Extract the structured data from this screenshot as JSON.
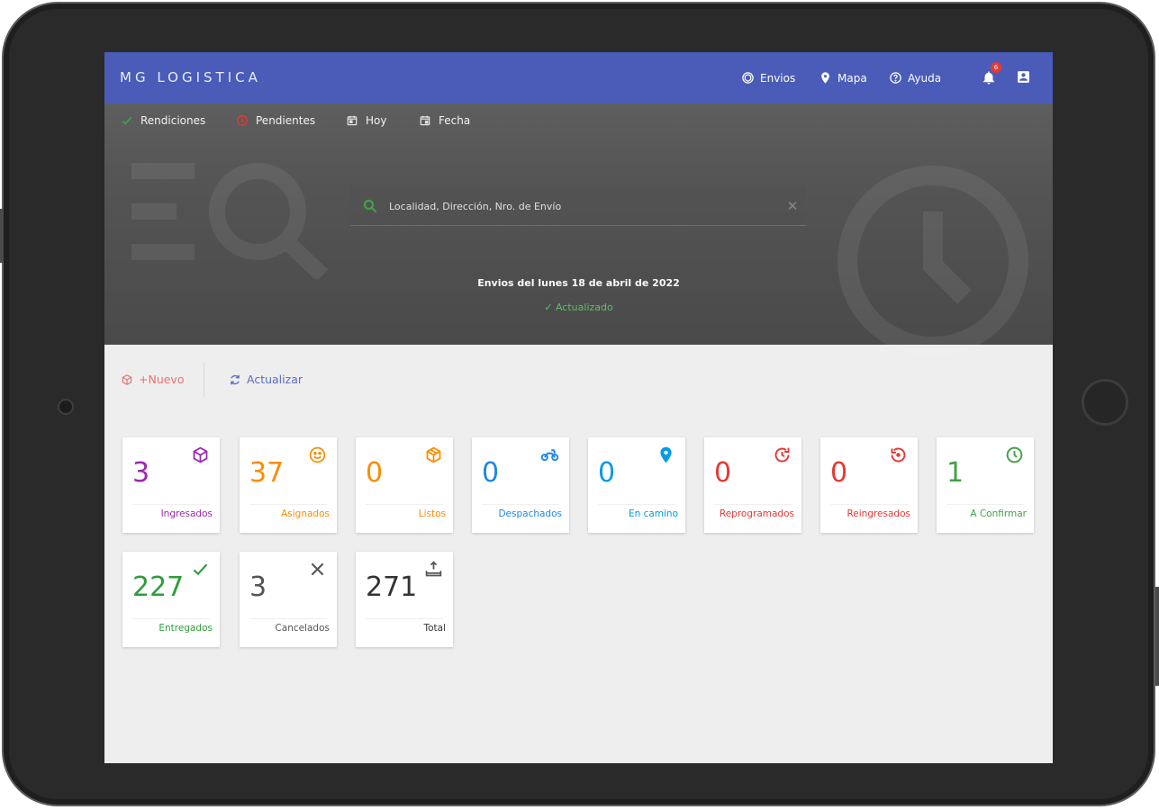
{
  "app": {
    "brand": "MG LOGISTICA"
  },
  "topnav": {
    "items": [
      {
        "label": "Envios",
        "icon": "package-icon"
      },
      {
        "label": "Mapa",
        "icon": "map-pin-icon"
      },
      {
        "label": "Ayuda",
        "icon": "help-icon"
      }
    ],
    "notification_count": "6"
  },
  "filters": {
    "items": [
      {
        "label": "Rendiciones",
        "icon": "check-icon",
        "color": "#43a047"
      },
      {
        "label": "Pendientes",
        "icon": "clock-icon",
        "color": "#e53935"
      },
      {
        "label": "Hoy",
        "icon": "calendar-today-icon",
        "color": "#e0e0e0"
      },
      {
        "label": "Fecha",
        "icon": "calendar-icon",
        "color": "#e0e0e0"
      }
    ]
  },
  "search": {
    "placeholder": "Localidad, Dirección, Nro. de Envío"
  },
  "summary": {
    "date_text": "Envios del lunes 18 de abril de 2022",
    "status_text": "✓ Actualizado"
  },
  "toolbar": {
    "new_label": "+Nuevo",
    "refresh_label": "Actualizar"
  },
  "stats": [
    {
      "value": "3",
      "label": "Ingresados",
      "color": "#9c27b0",
      "icon": "cube-icon"
    },
    {
      "value": "37",
      "label": "Asignados",
      "color": "#fb8c00",
      "icon": "smiley-icon"
    },
    {
      "value": "0",
      "label": "Listos",
      "color": "#fb8c00",
      "icon": "package-icon"
    },
    {
      "value": "0",
      "label": "Despachados",
      "color": "#1e88e5",
      "icon": "motorcycle-icon"
    },
    {
      "value": "0",
      "label": "En camino",
      "color": "#039be5",
      "icon": "map-pin-icon"
    },
    {
      "value": "0",
      "label": "Reprogramados",
      "color": "#e53935",
      "icon": "reschedule-icon"
    },
    {
      "value": "0",
      "label": "Reingresados",
      "color": "#e53935",
      "icon": "history-icon"
    },
    {
      "value": "1",
      "label": "A Confirmar",
      "color": "#43a047",
      "icon": "clock-icon"
    },
    {
      "value": "227",
      "label": "Entregados",
      "color": "#2e9d3a",
      "icon": "check-icon"
    },
    {
      "value": "3",
      "label": "Cancelados",
      "color": "#555555",
      "icon": "close-icon"
    },
    {
      "value": "271",
      "label": "Total",
      "color": "#333333",
      "icon": "inbox-upload-icon"
    }
  ]
}
